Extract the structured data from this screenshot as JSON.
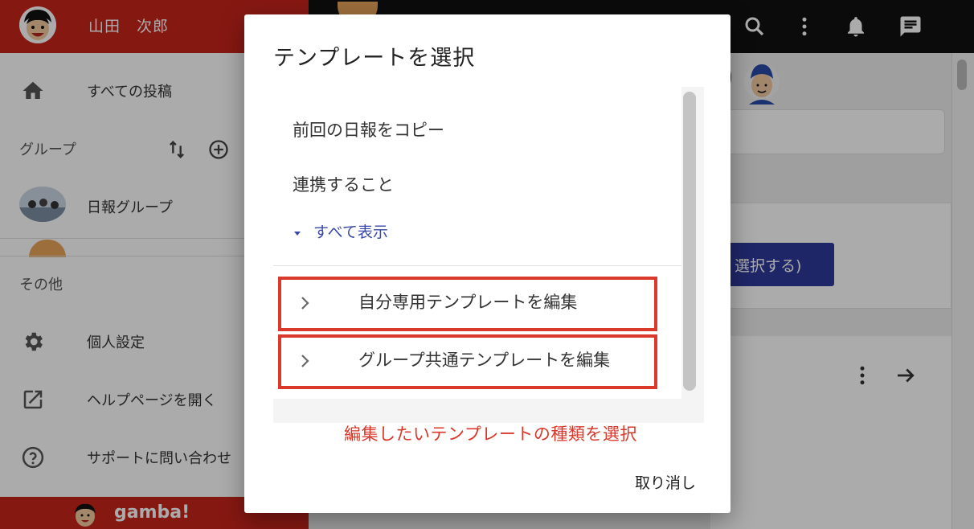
{
  "user": {
    "name": "山田　次郎"
  },
  "sidebar": {
    "all_posts": "すべての投稿",
    "groups_label": "グループ",
    "group_item": "日報グループ",
    "other_label": "その他",
    "settings": "個人設定",
    "help": "ヘルプページを開く",
    "support": "サポートに問い合わせ",
    "footer_logo": "gamba!"
  },
  "main": {
    "select_button": "選択する)"
  },
  "dialog": {
    "title": "テンプレートを選択",
    "templates": [
      "前回の日報をコピー",
      "連携すること"
    ],
    "show_all": "すべて表示",
    "edit_own": "自分専用テンプレートを編集",
    "edit_group": "グループ共通テンプレートを編集",
    "annotation": "編集したいテンプレートの種類を選択",
    "cancel": "取り消し"
  },
  "colors": {
    "brand_red": "#c8251c",
    "highlight_red": "#d9382a",
    "link_blue": "#3848a8",
    "button_blue": "#2d3a9c"
  }
}
